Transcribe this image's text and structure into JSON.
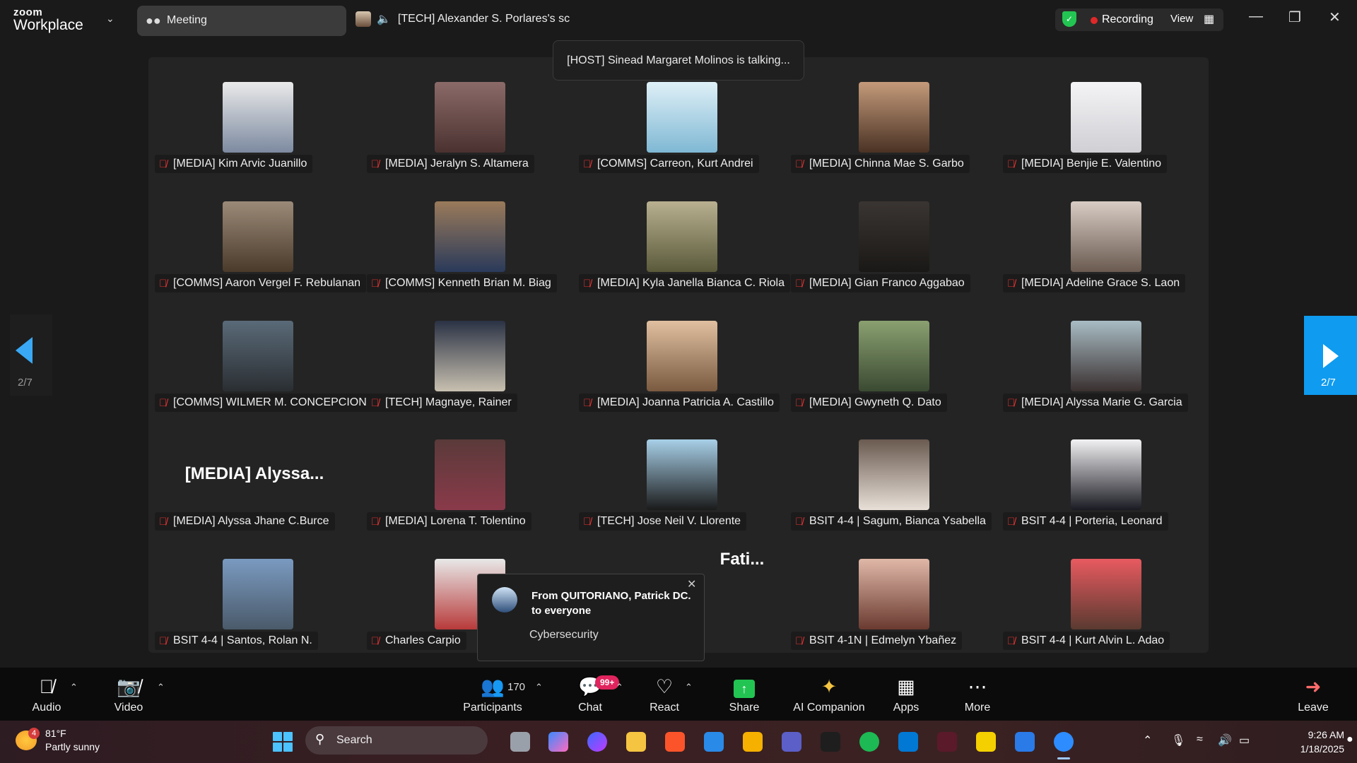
{
  "app": {
    "brand_top": "zoom",
    "brand_bottom": "Workplace"
  },
  "tabs": {
    "meeting_label": "Meeting",
    "share_label": "[TECH] Alexander S. Porlares's sc"
  },
  "header": {
    "recording_label": "Recording",
    "view_label": "View"
  },
  "talking_toast": "[HOST] Sinead Margaret Molinos is talking...",
  "gallery": {
    "page_indicator": "2/7",
    "participants": [
      {
        "name": "[MEDIA] Kim Arvic Juanillo",
        "muted": true,
        "avatar_color": "#c8ccd6"
      },
      {
        "name": "[MEDIA] Jeralyn S. Altamera",
        "muted": true,
        "avatar_color": "#6b4a48"
      },
      {
        "name": "[COMMS] Carreon, Kurt Andrei",
        "muted": true,
        "avatar_color": "#b9dceb"
      },
      {
        "name": "[MEDIA] Chinna Mae S. Garbo",
        "muted": true,
        "avatar_color": "#8c6a52"
      },
      {
        "name": "[MEDIA] Benjie E. Valentino",
        "muted": true,
        "avatar_color": "#e9eaec"
      },
      {
        "name": "[COMMS] Aaron Vergel F. Rebulanan",
        "muted": true,
        "avatar_color": "#7d6a58"
      },
      {
        "name": "[COMMS] Kenneth Brian M. Biag",
        "muted": true,
        "avatar_color": "#6a4a32"
      },
      {
        "name": "[MEDIA] Kyla Janella Bianca C. Riola",
        "muted": true,
        "avatar_color": "#9a8e72"
      },
      {
        "name": "[MEDIA] Gian Franco Aggabao",
        "muted": true,
        "avatar_color": "#2e2a28"
      },
      {
        "name": "[MEDIA] Adeline Grace S. Laon",
        "muted": true,
        "avatar_color": "#b8a89c"
      },
      {
        "name": "[COMMS] WILMER M. CONCEPCION",
        "muted": true,
        "avatar_color": "#3e4a55"
      },
      {
        "name": "[TECH] Magnaye, Rainer",
        "muted": true,
        "avatar_color": "#3a4252"
      },
      {
        "name": "[MEDIA] Joanna Patricia A. Castillo",
        "muted": true,
        "avatar_color": "#c49a7a"
      },
      {
        "name": "[MEDIA] Gwyneth Q. Dato",
        "muted": true,
        "avatar_color": "#6f8a62"
      },
      {
        "name": "[MEDIA] Alyssa Marie G. Garcia",
        "muted": true,
        "avatar_color": "#8aa0a8"
      },
      {
        "name": "[MEDIA] Alyssa Jhane C.Burce",
        "muted": true,
        "video_off_name": "[MEDIA]  Alyssa..."
      },
      {
        "name": "[MEDIA] Lorena T. Tolentino",
        "muted": true,
        "avatar_color": "#4a2a2a"
      },
      {
        "name": "[TECH] Jose Neil V. Llorente",
        "muted": true,
        "avatar_color": "#8ebbd6"
      },
      {
        "name": "BSIT 4-4 | Sagum, Bianca Ysabella",
        "muted": true,
        "avatar_color": "#5a4640"
      },
      {
        "name": "BSIT 4-4 | Porteria, Leonard",
        "muted": true,
        "avatar_color": "#e8e8ea"
      },
      {
        "name": "BSIT 4-4 | Santos, Rolan N.",
        "muted": true,
        "avatar_color": "#5e7fa8"
      },
      {
        "name": "Charles Carpio",
        "muted": true,
        "avatar_color": "#a8463e"
      },
      {
        "name": "",
        "muted": false,
        "video_off_name": "Fati..."
      },
      {
        "name": "BSIT 4-1N | Edmelyn Ybañez",
        "muted": true,
        "avatar_color": "#c0706a"
      },
      {
        "name": "BSIT 4-4 | Kurt Alvin L. Adao",
        "muted": true,
        "avatar_color": "#d44a50"
      }
    ]
  },
  "chat_toast": {
    "from": "From QUITORIANO, Patrick DC. to everyone",
    "message": "Cybersecurity"
  },
  "toolbar": {
    "audio": "Audio",
    "video": "Video",
    "participants": "Participants",
    "participants_count": "170",
    "chat": "Chat",
    "chat_badge": "99+",
    "react": "React",
    "share": "Share",
    "ai_companion": "AI Companion",
    "apps": "Apps",
    "more": "More",
    "leave": "Leave"
  },
  "taskbar": {
    "weather_temp": "81°F",
    "weather_desc": "Partly sunny",
    "weather_badge": "4",
    "search_label": "Search",
    "time": "9:26 AM",
    "date": "1/18/2025"
  }
}
